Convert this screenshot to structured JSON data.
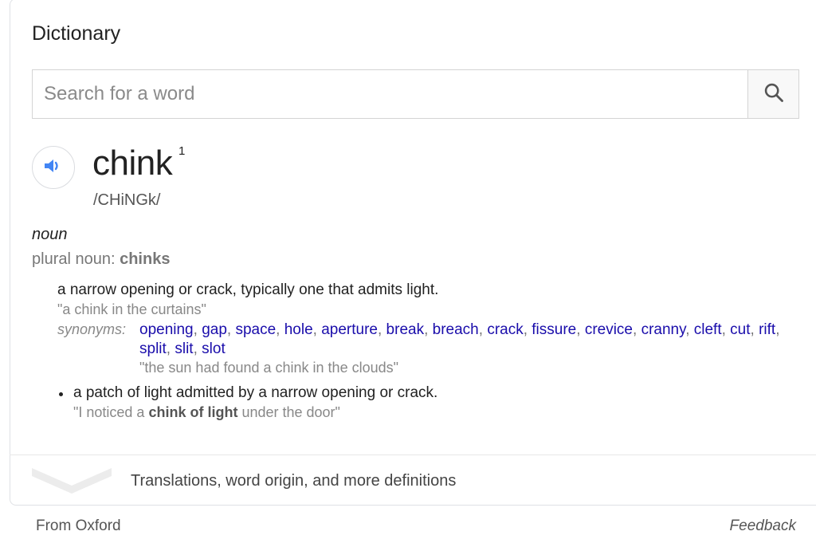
{
  "card": {
    "title": "Dictionary"
  },
  "search": {
    "placeholder": "Search for a word",
    "value": "",
    "icon": "search-icon"
  },
  "entry": {
    "speaker_icon": "speaker-icon",
    "headword": "chink",
    "homograph_number": "1",
    "phonetic": "/CHiNGk/",
    "part_of_speech": "noun",
    "plural_label": "plural noun: ",
    "plural_value": "chinks",
    "senses": [
      {
        "definition": "a narrow opening or crack, typically one that admits light.",
        "example": "\"a chink in the curtains\"",
        "synonyms_label": "synonyms:",
        "synonyms": [
          "opening",
          "gap",
          "space",
          "hole",
          "aperture",
          "break",
          "breach",
          "crack",
          "fissure",
          "crevice",
          "cranny",
          "cleft",
          "cut",
          "rift",
          "split",
          "slit",
          "slot"
        ],
        "synonym_example": "\"the sun had found a chink in the clouds\""
      },
      {
        "definition": "a patch of light admitted by a narrow opening or crack.",
        "example_prefix": "\"I noticed a ",
        "example_bold": "chink of light",
        "example_suffix": " under the door\""
      }
    ]
  },
  "more": {
    "label": "Translations, word origin, and more definitions",
    "icon": "chevron-down-icon"
  },
  "footer": {
    "source": "From Oxford",
    "feedback": "Feedback"
  },
  "colors": {
    "link": "#1a0dab",
    "speaker": "#4285f4",
    "muted": "#888888"
  }
}
